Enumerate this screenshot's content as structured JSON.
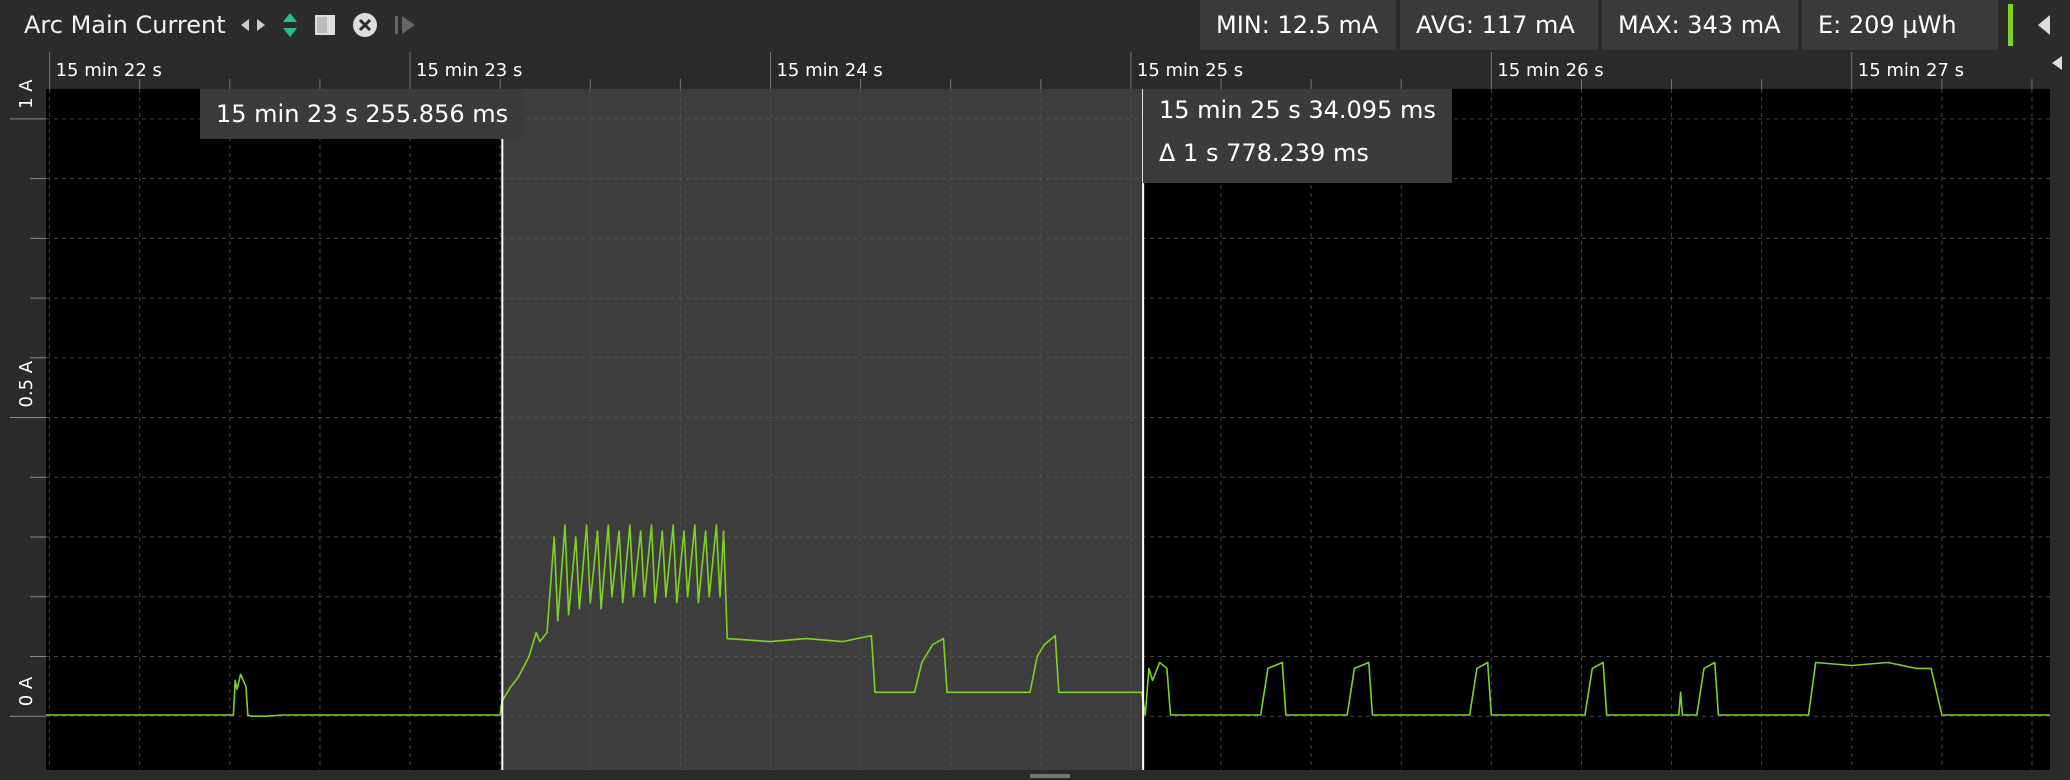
{
  "toolbar": {
    "title": "Arc Main Current",
    "stats": {
      "min": "MIN: 12.5 mA",
      "avg": "AVG: 117 mA",
      "max": "MAX: 343 mA",
      "energy": "E: 209 µWh"
    },
    "icons": [
      "expand-horizontal-icon",
      "expand-vertical-icon",
      "square-icon",
      "close-circle-icon",
      "play-step-icon",
      "collapse-arrow-icon"
    ]
  },
  "cursors": {
    "left_time": "15 min 23 s 255.856 ms",
    "right_time": "15 min 25 s 34.095 ms",
    "delta": "Δ 1 s 778.239 ms"
  },
  "colors": {
    "trace": "#7ed321",
    "background": "#000000",
    "selection": "#3d3d3d",
    "panel": "#2a2a2a"
  },
  "chart_data": {
    "type": "line",
    "title": "Arc Main Current",
    "x_tick_labels": [
      "15 min 22 s",
      "15 min 23 s",
      "15 min 24 s",
      "15 min 25 s",
      "15 min 26 s",
      "15 min 27 s"
    ],
    "x_ticks_seconds": [
      922,
      923,
      924,
      925,
      926,
      927
    ],
    "y_tick_labels": [
      "0 A",
      "0.5 A",
      "1 A"
    ],
    "y_ticks_amps": [
      0,
      0.5,
      1
    ],
    "xlim_seconds": [
      921.99,
      927.55
    ],
    "ylim_amps": [
      -0.09,
      1.05
    ],
    "grid": true,
    "selection_seconds": [
      923.256,
      925.034
    ],
    "series": [
      {
        "values_amps_by_time": [
          [
            921.99,
            0.002
          ],
          [
            922.51,
            0.002
          ],
          [
            922.515,
            0.06
          ],
          [
            922.52,
            0.045
          ],
          [
            922.53,
            0.07
          ],
          [
            922.545,
            0.05
          ],
          [
            922.55,
            0.002
          ],
          [
            922.56,
            0.0
          ],
          [
            922.6,
            0.0
          ],
          [
            922.65,
            0.002
          ],
          [
            923.25,
            0.002
          ],
          [
            923.255,
            0.025
          ],
          [
            923.28,
            0.05
          ],
          [
            923.3,
            0.065
          ],
          [
            923.33,
            0.1
          ],
          [
            923.34,
            0.12
          ],
          [
            923.35,
            0.14
          ],
          [
            923.36,
            0.125
          ],
          [
            923.38,
            0.14
          ],
          [
            923.4,
            0.3
          ],
          [
            923.41,
            0.16
          ],
          [
            923.43,
            0.32
          ],
          [
            923.44,
            0.17
          ],
          [
            923.46,
            0.3
          ],
          [
            923.47,
            0.18
          ],
          [
            923.49,
            0.32
          ],
          [
            923.5,
            0.19
          ],
          [
            923.52,
            0.31
          ],
          [
            923.53,
            0.18
          ],
          [
            923.55,
            0.32
          ],
          [
            923.56,
            0.2
          ],
          [
            923.58,
            0.31
          ],
          [
            923.59,
            0.19
          ],
          [
            923.61,
            0.32
          ],
          [
            923.62,
            0.2
          ],
          [
            923.64,
            0.31
          ],
          [
            923.65,
            0.2
          ],
          [
            923.67,
            0.32
          ],
          [
            923.68,
            0.19
          ],
          [
            923.7,
            0.31
          ],
          [
            923.71,
            0.2
          ],
          [
            923.73,
            0.32
          ],
          [
            923.74,
            0.19
          ],
          [
            923.76,
            0.31
          ],
          [
            923.77,
            0.2
          ],
          [
            923.79,
            0.32
          ],
          [
            923.8,
            0.19
          ],
          [
            923.82,
            0.31
          ],
          [
            923.83,
            0.2
          ],
          [
            923.85,
            0.32
          ],
          [
            923.86,
            0.2
          ],
          [
            923.87,
            0.31
          ],
          [
            923.88,
            0.13
          ],
          [
            924.0,
            0.125
          ],
          [
            924.1,
            0.13
          ],
          [
            924.2,
            0.125
          ],
          [
            924.28,
            0.135
          ],
          [
            924.29,
            0.04
          ],
          [
            924.4,
            0.04
          ],
          [
            924.42,
            0.09
          ],
          [
            924.45,
            0.12
          ],
          [
            924.48,
            0.13
          ],
          [
            924.49,
            0.04
          ],
          [
            924.72,
            0.04
          ],
          [
            924.74,
            0.1
          ],
          [
            924.76,
            0.12
          ],
          [
            924.79,
            0.135
          ],
          [
            924.8,
            0.04
          ],
          [
            925.03,
            0.04
          ],
          [
            925.04,
            0.002
          ],
          [
            925.05,
            0.08
          ],
          [
            925.06,
            0.06
          ],
          [
            925.08,
            0.09
          ],
          [
            925.1,
            0.08
          ],
          [
            925.11,
            0.002
          ],
          [
            925.36,
            0.002
          ],
          [
            925.38,
            0.08
          ],
          [
            925.42,
            0.09
          ],
          [
            925.43,
            0.002
          ],
          [
            925.6,
            0.002
          ],
          [
            925.62,
            0.08
          ],
          [
            925.66,
            0.09
          ],
          [
            925.67,
            0.002
          ],
          [
            925.94,
            0.002
          ],
          [
            925.96,
            0.08
          ],
          [
            925.99,
            0.09
          ],
          [
            926.0,
            0.002
          ],
          [
            926.26,
            0.002
          ],
          [
            926.28,
            0.08
          ],
          [
            926.31,
            0.09
          ],
          [
            926.32,
            0.002
          ],
          [
            926.52,
            0.002
          ],
          [
            926.525,
            0.04
          ],
          [
            926.53,
            0.002
          ],
          [
            926.57,
            0.002
          ],
          [
            926.59,
            0.08
          ],
          [
            926.62,
            0.09
          ],
          [
            926.63,
            0.002
          ],
          [
            926.88,
            0.002
          ],
          [
            926.9,
            0.09
          ],
          [
            927.0,
            0.085
          ],
          [
            927.1,
            0.09
          ],
          [
            927.18,
            0.08
          ],
          [
            927.22,
            0.08
          ],
          [
            927.25,
            0.002
          ],
          [
            927.55,
            0.002
          ]
        ]
      }
    ]
  }
}
